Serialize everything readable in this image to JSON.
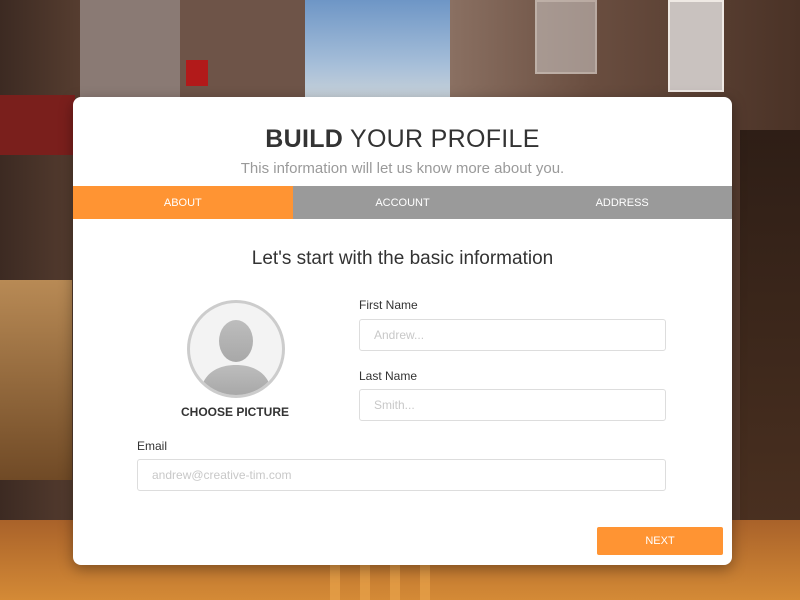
{
  "wizard": {
    "title_bold": "BUILD",
    "title_rest": " YOUR PROFILE",
    "subtitle": "This information will let us know more about you.",
    "tabs": [
      {
        "label": "ABOUT",
        "active": true
      },
      {
        "label": "ACCOUNT",
        "active": false
      },
      {
        "label": "ADDRESS",
        "active": false
      }
    ],
    "section_title": "Let's start with the basic information",
    "choose_picture_label": "CHOOSE PICTURE",
    "fields": {
      "first_name": {
        "label": "First Name",
        "placeholder": "Andrew...",
        "value": ""
      },
      "last_name": {
        "label": "Last Name",
        "placeholder": "Smith...",
        "value": ""
      },
      "email": {
        "label": "Email",
        "placeholder": "andrew@creative-tim.com",
        "value": ""
      }
    },
    "next_label": "NEXT",
    "colors": {
      "accent": "#ff9433",
      "tab_inactive": "#9a9a9a",
      "card_bg": "#ffffff",
      "text": "#333333",
      "muted_text": "#9a9a9a"
    }
  },
  "background": {
    "icon": "street-photo"
  }
}
